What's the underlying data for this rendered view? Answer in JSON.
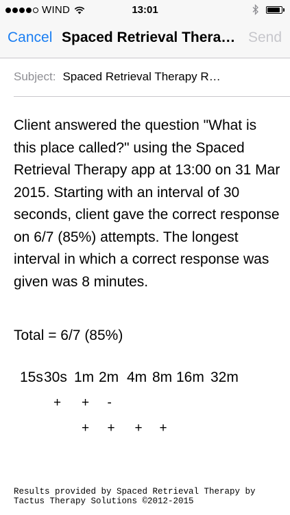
{
  "status_bar": {
    "carrier": "WIND",
    "time": "13:01",
    "signal_strength": 4,
    "signal_max": 5,
    "battery_level": 0.9,
    "icons": [
      "wifi-icon",
      "bluetooth-icon",
      "battery-icon"
    ]
  },
  "nav": {
    "cancel_label": "Cancel",
    "title": "Spaced Retrieval Therapy Results",
    "send_label": "Send",
    "accent_color": "#1a7ef2",
    "disabled_color": "#c7c7cc"
  },
  "subject": {
    "label": "Subject:",
    "value": "Spaced Retrieval Therapy Results"
  },
  "message": {
    "body": "Client answered the question \"What is this place called?\" using the Spaced Retrieval Therapy app at 13:00 on 31 Mar 2015. Starting with an interval of 30 seconds, client gave the correct response on 6/7 (85%) attempts. The longest interval in which a correct response was given was 8 minutes.",
    "total": "Total = 6/7 (85%)",
    "intervals": [
      "15s",
      "30s",
      "1m",
      "2m",
      "4m",
      "8m",
      "16m",
      "32m"
    ],
    "attempt_rows": [
      [
        "",
        "+",
        "+",
        "-",
        "",
        "",
        "",
        ""
      ],
      [
        "",
        "",
        "+",
        "+",
        "+",
        "+",
        "",
        ""
      ]
    ],
    "footer": "Results provided by Spaced Retrieval Therapy by Tactus Therapy Solutions ©2012-2015"
  }
}
